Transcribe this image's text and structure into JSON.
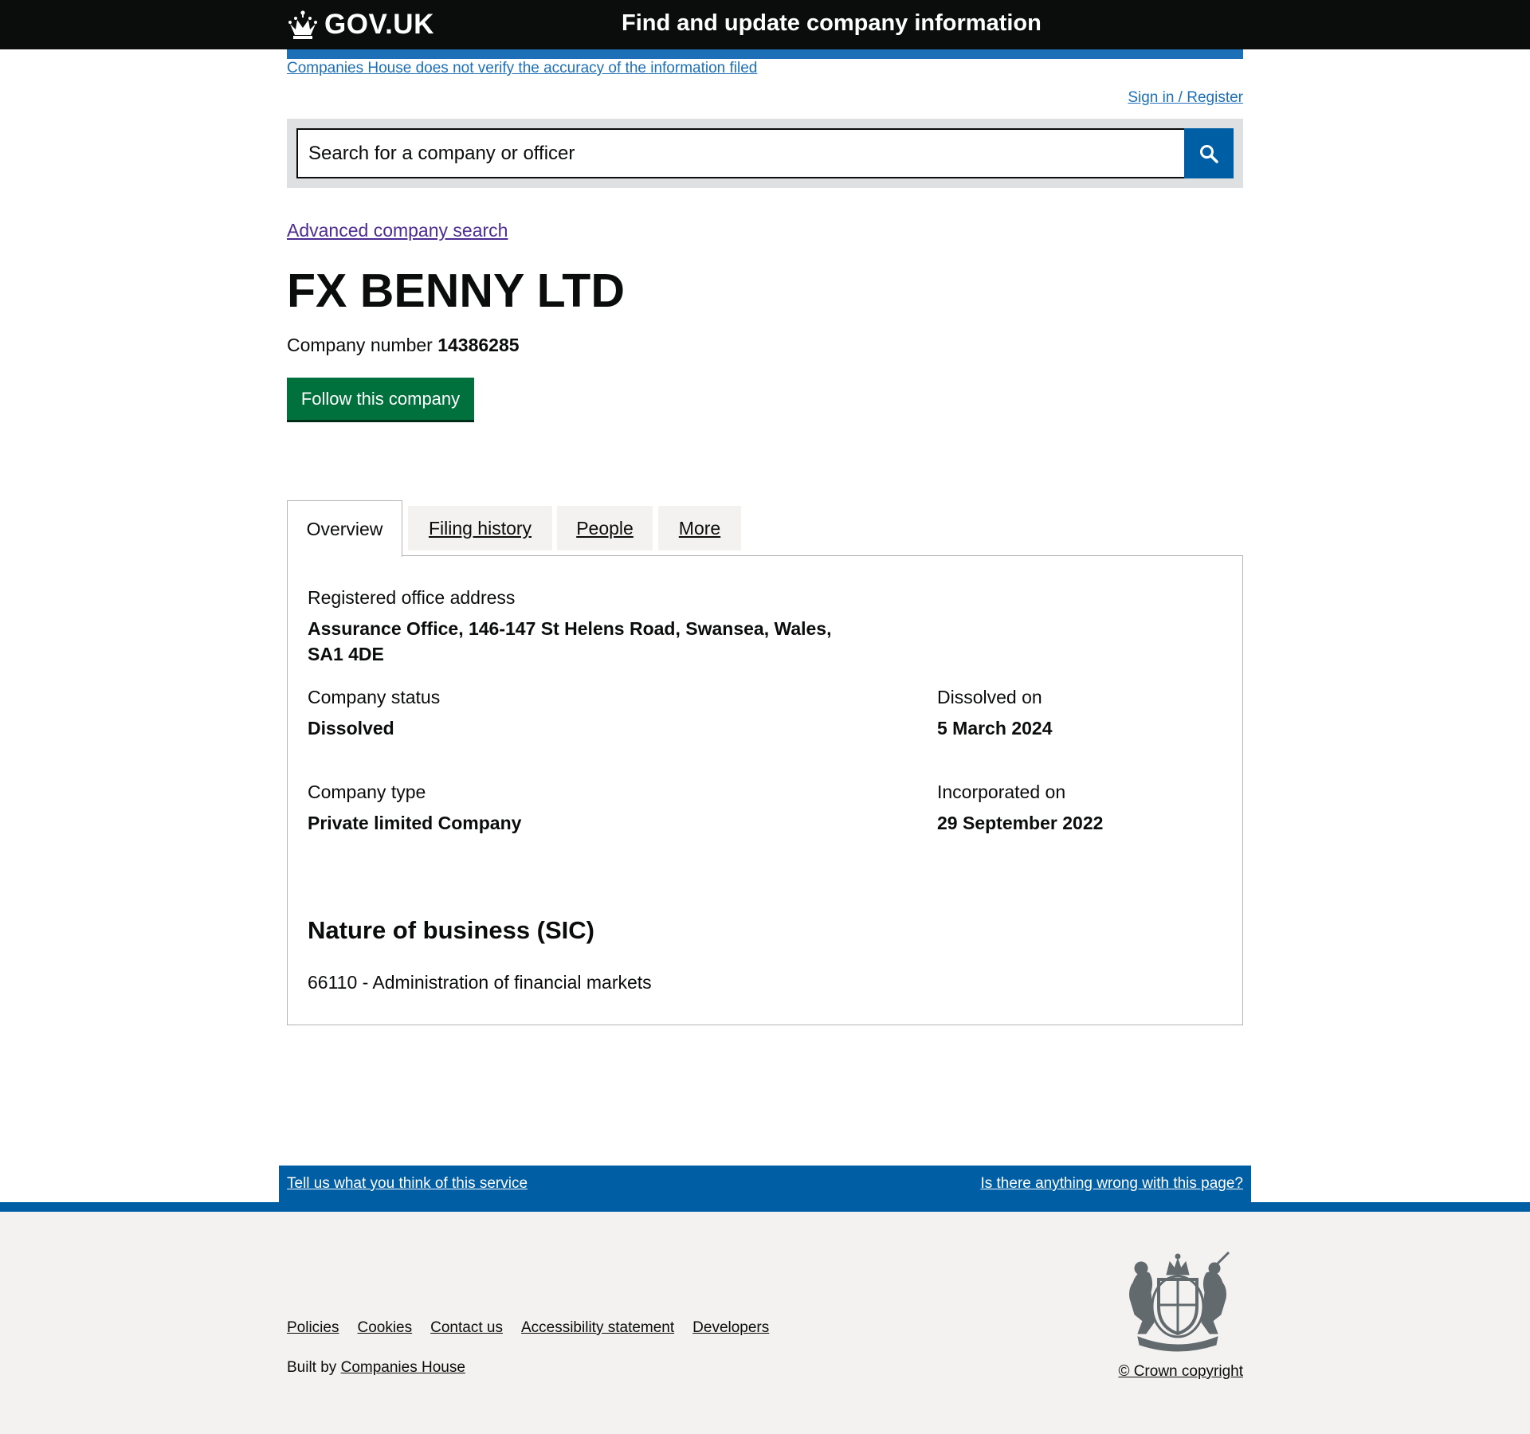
{
  "header": {
    "logo_text": "GOV.UK",
    "service_name": "Find and update company information",
    "disclaimer": "Companies House does not verify the accuracy of the information filed",
    "sign_in": "Sign in / Register"
  },
  "search": {
    "placeholder": "Search for a company or officer",
    "button_icon": "search-icon"
  },
  "advanced_search": "Advanced company search",
  "company": {
    "name": "FX BENNY LTD",
    "number_label": "Company number",
    "number": "14386285",
    "follow_label": "Follow this company"
  },
  "tabs": [
    {
      "label": "Overview",
      "selected": true
    },
    {
      "label": "Filing history",
      "selected": false
    },
    {
      "label": "People",
      "selected": false
    },
    {
      "label": "More",
      "selected": false
    }
  ],
  "overview": {
    "address_label": "Registered office address",
    "address_value": "Assurance Office, 146-147 St Helens Road, Swansea, Wales, SA1 4DE",
    "status_label": "Company status",
    "status_value": "Dissolved",
    "dissolved_label": "Dissolved on",
    "dissolved_value": "5 March 2024",
    "type_label": "Company type",
    "type_value": "Private limited Company",
    "incorporated_label": "Incorporated on",
    "incorporated_value": "29 September 2022",
    "sic_heading": "Nature of business (SIC)",
    "sic_items": [
      "66110 - Administration of financial markets"
    ]
  },
  "feedback": {
    "left": "Tell us what you think of this service",
    "right": "Is there anything wrong with this page?"
  },
  "footer": {
    "links": [
      "Policies",
      "Cookies",
      "Contact us",
      "Accessibility statement",
      "Developers"
    ],
    "built_by_prefix": "Built by",
    "built_by_link": "Companies House",
    "copyright": "© Crown copyright"
  },
  "colors": {
    "header_bg": "#0b0c0c",
    "link_blue": "#1d70b8",
    "visited_purple": "#4c2c92",
    "search_button": "#005ea5",
    "follow_green": "#00703c",
    "footer_bg": "#f3f2f1"
  }
}
